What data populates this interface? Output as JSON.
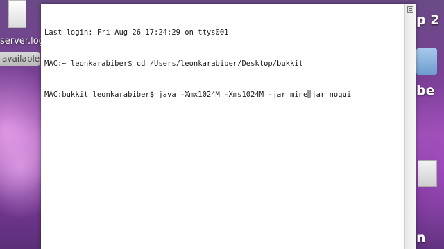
{
  "desktop": {
    "left_file_label": "server.log",
    "left_badge": "available",
    "right_partial_1": "p 2",
    "right_partial_2": "be",
    "right_partial_3": "n"
  },
  "terminal": {
    "lines": [
      "Last login: Fri Aug 26 17:24:29 on ttys001",
      "MAC:~ leonkarabiber$ cd /Users/leonkarabiber/Desktop/bukkit"
    ],
    "command_prompt": "MAC:bukkit leonkarabiber$ java -Xmx1024M -Xms1024M -jar mine",
    "command_after_cursor": "jar nogui"
  },
  "colors": {
    "terminal_background": "#ffffff",
    "terminal_text": "#1a1a1a",
    "desktop_accent": "#7a3f96"
  },
  "icons": {
    "scroll_split": "split-pane-icon",
    "left_file": "document-icon",
    "right_folder": "folder-icon"
  }
}
